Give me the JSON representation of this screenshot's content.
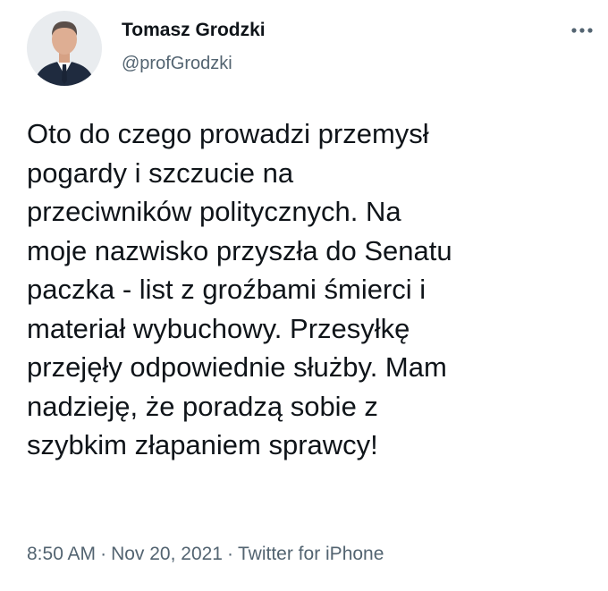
{
  "author": {
    "display_name": "Tomasz Grodzki",
    "handle": "@profGrodzki",
    "avatar_icon": "avatar-photo"
  },
  "header": {
    "more_icon": "more-options-icon"
  },
  "tweet": {
    "text": "Oto do czego prowadzi przemysł\npogardy i szczucie na\nprzeciwników politycznych. Na\nmoje nazwisko przyszła do Senatu\npaczka - list z groźbami śmierci i\nmateriał wybuchowy. Przesyłkę\nprzejęły odpowiednie służby. Mam\nnadzieję, że poradzą sobie z\nszybkim złapaniem sprawcy!"
  },
  "meta": {
    "time": "8:50 AM",
    "separator": "·",
    "date": "Nov 20, 2021",
    "source": "Twitter for iPhone"
  },
  "colors": {
    "text_primary": "#0f1419",
    "text_secondary": "#536471",
    "background": "#ffffff"
  }
}
